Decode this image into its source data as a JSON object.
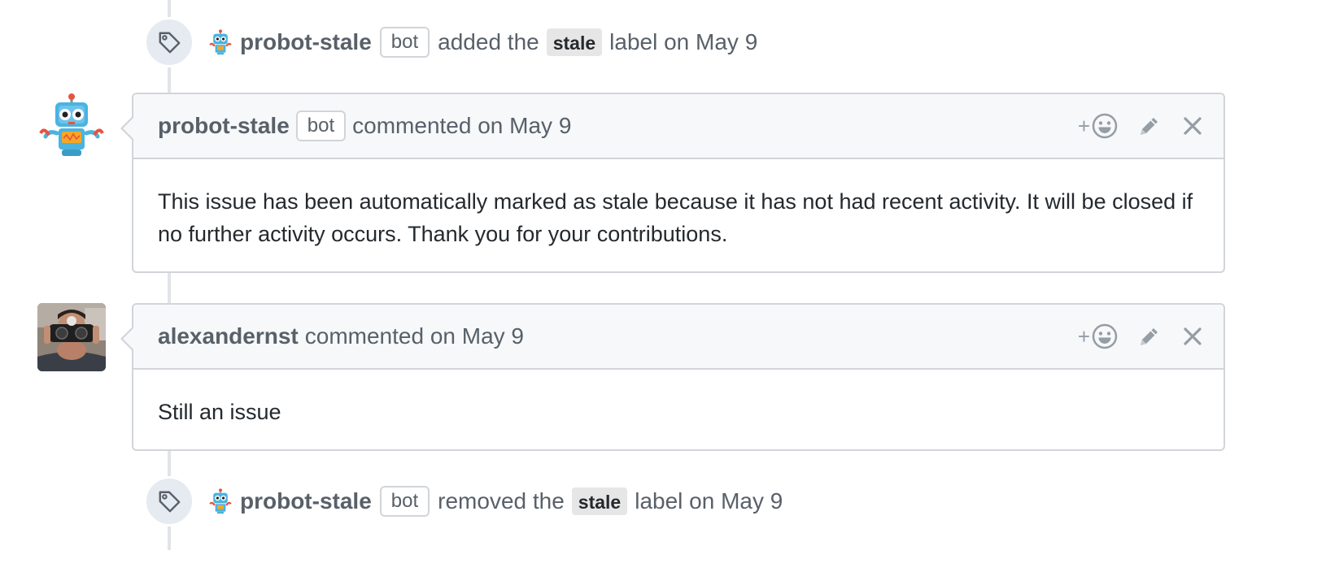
{
  "events": [
    {
      "author": "probot-stale",
      "badge": "bot",
      "action": "added the",
      "label": "stale",
      "suffix": "label on May 9"
    },
    {
      "author": "probot-stale",
      "badge": "bot",
      "action": "removed the",
      "label": "stale",
      "suffix": "label on May 9"
    }
  ],
  "comments": [
    {
      "author": "probot-stale",
      "badge": "bot",
      "meta": "commented on May 9",
      "body": "This issue has been automatically marked as stale because it has not had recent activity. It will be closed if no further activity occurs. Thank you for your contributions."
    },
    {
      "author": "alexandernst",
      "meta": "commented on May 9",
      "body": "Still an issue"
    }
  ],
  "actions": {
    "react_plus": "+",
    "icons": [
      "smiley-icon",
      "pencil-icon",
      "close-icon"
    ]
  },
  "colors": {
    "timeline": "#e1e4e8",
    "badge_bg": "#e6ebf1",
    "header_bg": "#f6f8fa",
    "border": "#d1d5da",
    "muted_text": "#586069",
    "label_bg": "#e6e6e6",
    "robot_blue": "#4ab3e0"
  }
}
